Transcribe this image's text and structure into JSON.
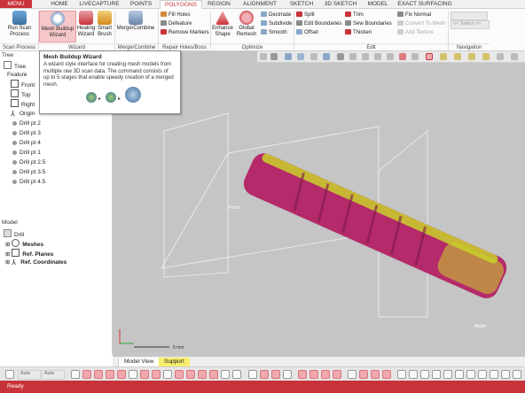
{
  "tabs": [
    "MENU",
    "HOME",
    "LIVECAPTURE",
    "POINTS",
    "POLYGONS",
    "REGION",
    "ALIGNMENT",
    "SKETCH",
    "3D SKETCH",
    "MODEL",
    "EXACT SURFACING"
  ],
  "ribbon": {
    "run_scan_process": "Run Scan\nProcess",
    "mesh_buildup_wizard": "Mesh Buildup\nWizard",
    "healing_wizard": "Healing\nWizard",
    "smart_brush": "Smart\nBrush",
    "merge_combine": "Merge/Combine",
    "fill_holes": "Fill Holes",
    "defeature": "Defeature",
    "remove_markers": "Remove Markers",
    "enhance_shape": "Enhance\nShape",
    "global_remesh": "Global\nRemesh",
    "decimate": "Decimate",
    "subdivide": "Subdivide",
    "smooth": "Smooth",
    "split": "Split",
    "edit_boundaries": "Edit Boundaries",
    "offset": "Offset",
    "trim": "Trim",
    "sew_boundaries": "Sew Boundaries",
    "thicken": "Thicken",
    "fix_normal": "Fix Normal",
    "convert_to_mesh": "Convert To Mesh",
    "add_texture": "Add Texture",
    "select_label": "Select",
    "groups": {
      "scan_process": "Scan Process",
      "wizard": "Wizard",
      "merge_combine": "Merge/Combine",
      "repair": "Repair Holes/Boss",
      "optimize": "Optimize",
      "edit": "Edit",
      "navigation": "Navigation"
    }
  },
  "tooltip": {
    "title": "Mesh Buildup Wizard",
    "body": "A wizard style interface for creating mesh models from multiple raw 3D scan data. The command consists of up to 5 stages that enable speedy creation of a merged mesh."
  },
  "tree": {
    "header": "Tree",
    "tab": "Tree",
    "feature": "Feature",
    "items": [
      "Front",
      "Top",
      "Right",
      "Origin",
      "Drill pt 2",
      "Drill pt 3",
      "Drill pt 4",
      "Drill pt 1",
      "Drill pt 2.5",
      "Drill pt 3.5",
      "Drill pt 4.5"
    ]
  },
  "model": {
    "header": "Model",
    "root": "Drill",
    "items": [
      "Meshes",
      "Ref. Planes",
      "Ref. Coordinates"
    ]
  },
  "viewport": {
    "front_label": "Front",
    "right_label": "Right",
    "scale_label": "5 mm"
  },
  "bottom_tabs": [
    "Model View",
    "Support"
  ],
  "bottom_bar": {
    "auto1": "Auto",
    "auto2": "Auto"
  },
  "status": "Ready",
  "colors": {
    "accent": "#c8333a",
    "mesh_magenta": "#b52a6a",
    "mesh_yellow": "#c9d12a",
    "viewport_bg": "#c5c5c5"
  }
}
